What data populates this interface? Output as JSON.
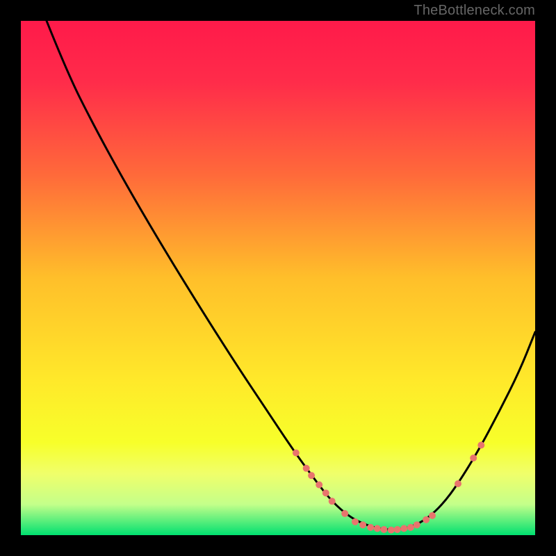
{
  "watermark": "TheBottleneck.com",
  "chart_data": {
    "type": "line",
    "title": "",
    "xlabel": "",
    "ylabel": "",
    "xlim": [
      0,
      100
    ],
    "ylim": [
      0,
      100
    ],
    "grid": false,
    "legend": false,
    "gradient_stops": [
      {
        "offset": 0.0,
        "color": "#ff1a4a"
      },
      {
        "offset": 0.12,
        "color": "#ff2c4a"
      },
      {
        "offset": 0.3,
        "color": "#ff6a3a"
      },
      {
        "offset": 0.5,
        "color": "#ffbf2a"
      },
      {
        "offset": 0.7,
        "color": "#ffe92a"
      },
      {
        "offset": 0.82,
        "color": "#f7ff2a"
      },
      {
        "offset": 0.88,
        "color": "#f0ff6a"
      },
      {
        "offset": 0.94,
        "color": "#c4ff8a"
      },
      {
        "offset": 1.0,
        "color": "#00e070"
      }
    ],
    "series": [
      {
        "name": "bottleneck-curve",
        "color": "#000000",
        "points": [
          {
            "x": 5.0,
            "y": 100.0
          },
          {
            "x": 9.0,
            "y": 90.0
          },
          {
            "x": 14.0,
            "y": 80.0
          },
          {
            "x": 20.0,
            "y": 69.0
          },
          {
            "x": 27.0,
            "y": 57.0
          },
          {
            "x": 35.0,
            "y": 44.0
          },
          {
            "x": 42.0,
            "y": 33.0
          },
          {
            "x": 48.0,
            "y": 24.0
          },
          {
            "x": 53.0,
            "y": 16.5
          },
          {
            "x": 57.0,
            "y": 11.0
          },
          {
            "x": 60.5,
            "y": 6.5
          },
          {
            "x": 64.0,
            "y": 3.5
          },
          {
            "x": 67.0,
            "y": 2.0
          },
          {
            "x": 70.0,
            "y": 1.2
          },
          {
            "x": 73.0,
            "y": 1.0
          },
          {
            "x": 76.0,
            "y": 1.6
          },
          {
            "x": 79.0,
            "y": 3.2
          },
          {
            "x": 82.0,
            "y": 6.0
          },
          {
            "x": 85.0,
            "y": 10.0
          },
          {
            "x": 89.0,
            "y": 16.5
          },
          {
            "x": 93.0,
            "y": 24.0
          },
          {
            "x": 97.0,
            "y": 32.0
          },
          {
            "x": 100.0,
            "y": 39.5
          }
        ]
      }
    ],
    "markers": [
      {
        "x": 53.5,
        "y": 16.0,
        "r": 5
      },
      {
        "x": 55.5,
        "y": 13.0,
        "r": 5
      },
      {
        "x": 56.5,
        "y": 11.6,
        "r": 5
      },
      {
        "x": 58.0,
        "y": 9.8,
        "r": 5
      },
      {
        "x": 59.3,
        "y": 8.2,
        "r": 5
      },
      {
        "x": 60.5,
        "y": 6.6,
        "r": 5
      },
      {
        "x": 63.0,
        "y": 4.2,
        "r": 5
      },
      {
        "x": 65.0,
        "y": 2.6,
        "r": 5
      },
      {
        "x": 66.5,
        "y": 2.0,
        "r": 5
      },
      {
        "x": 68.0,
        "y": 1.5,
        "r": 5
      },
      {
        "x": 69.3,
        "y": 1.3,
        "r": 5
      },
      {
        "x": 70.6,
        "y": 1.1,
        "r": 5
      },
      {
        "x": 72.0,
        "y": 1.0,
        "r": 5
      },
      {
        "x": 73.2,
        "y": 1.1,
        "r": 5
      },
      {
        "x": 74.5,
        "y": 1.3,
        "r": 5
      },
      {
        "x": 75.8,
        "y": 1.5,
        "r": 5
      },
      {
        "x": 77.0,
        "y": 2.0,
        "r": 5
      },
      {
        "x": 78.8,
        "y": 3.0,
        "r": 5
      },
      {
        "x": 80.0,
        "y": 3.8,
        "r": 5
      },
      {
        "x": 85.0,
        "y": 10.0,
        "r": 5
      },
      {
        "x": 88.0,
        "y": 15.0,
        "r": 5
      },
      {
        "x": 89.5,
        "y": 17.5,
        "r": 5
      }
    ],
    "marker_color": "#e8746d"
  }
}
